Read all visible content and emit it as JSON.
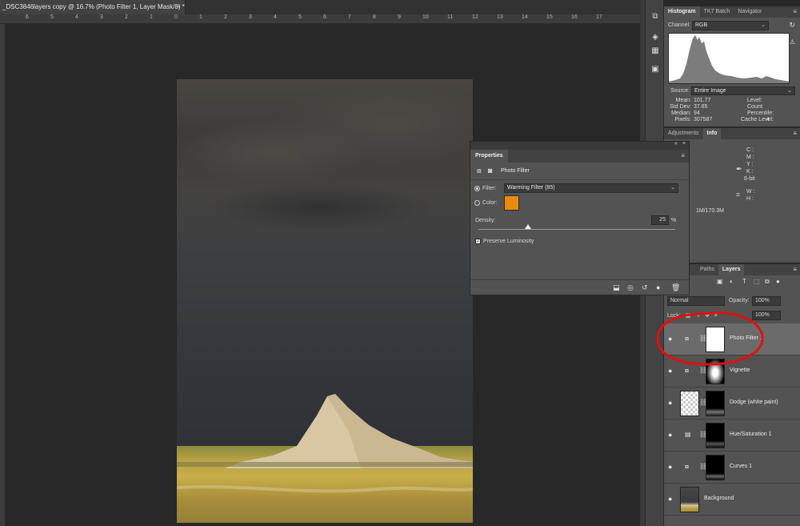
{
  "document": {
    "tab_title": "_DSC3846layers copy @ 16.7% (Photo Filter 1, Layer Mask/8) *",
    "close_glyph": "×"
  },
  "ruler": {
    "ticks": [
      "6",
      "5",
      "4",
      "3",
      "2",
      "1",
      "0",
      "1",
      "2",
      "3",
      "4",
      "5",
      "6",
      "7",
      "8",
      "9",
      "10",
      "11",
      "12",
      "13",
      "14",
      "15",
      "16",
      "17"
    ]
  },
  "histogram_panel": {
    "tabs": [
      "Histogram",
      "TK7 Batch",
      "Navigator"
    ],
    "active_tab": "Histogram",
    "menu_glyph": "≡",
    "channel_label": "Channel:",
    "channel_value": "RGB",
    "source_label": "Source:",
    "source_value": "Entire Image",
    "stats_left": [
      {
        "label": "Mean:",
        "value": "101.77"
      },
      {
        "label": "Std Dev:",
        "value": "37.85"
      },
      {
        "label": "Median:",
        "value": "94"
      },
      {
        "label": "Pixels:",
        "value": "307587"
      }
    ],
    "stats_right": [
      {
        "label": "Level:",
        "value": ""
      },
      {
        "label": "Count:",
        "value": ""
      },
      {
        "label": "Percentile:",
        "value": ""
      },
      {
        "label": "Cache Level:",
        "value": "4"
      }
    ]
  },
  "info_panel": {
    "tabs": [
      "Adjustments",
      "Info"
    ],
    "active_tab": "Info",
    "cmyk_labels": [
      "C :",
      "M :",
      "Y :",
      "K :"
    ],
    "bit_depth": "8-bit",
    "size_labels": [
      "W :",
      "H :"
    ],
    "doc_size": "1M/170.3M"
  },
  "layers_panel": {
    "tabs": [
      "Paths",
      "Layers"
    ],
    "active_tab": "Layers",
    "blend_mode": "Normal",
    "opacity_label": "Opacity:",
    "opacity_value": "100%",
    "lock_label": "Lock:",
    "fill_value": "100%",
    "layers": [
      {
        "name": "Photo Filter 1",
        "selected": true
      },
      {
        "name": "Vignette",
        "selected": false
      },
      {
        "name": "Dodge (white paint)",
        "selected": false
      },
      {
        "name": "Hue/Saturation 1",
        "selected": false
      },
      {
        "name": "Curves 1",
        "selected": false
      },
      {
        "name": "Background",
        "selected": false
      }
    ]
  },
  "properties_panel": {
    "tab": "Properties",
    "title": "Photo Filter",
    "filter_label": "Filter:",
    "filter_value": "Warming Filter (85)",
    "color_label": "Color:",
    "filter_color": "#ea8a0c",
    "density_label": "Density:",
    "density_value": "25",
    "density_unit": "%",
    "density_fraction": 0.25,
    "preserve_luminosity_label": "Preserve Luminosity",
    "preserve_luminosity": true
  },
  "colors": {
    "annotation": "#e01010"
  }
}
